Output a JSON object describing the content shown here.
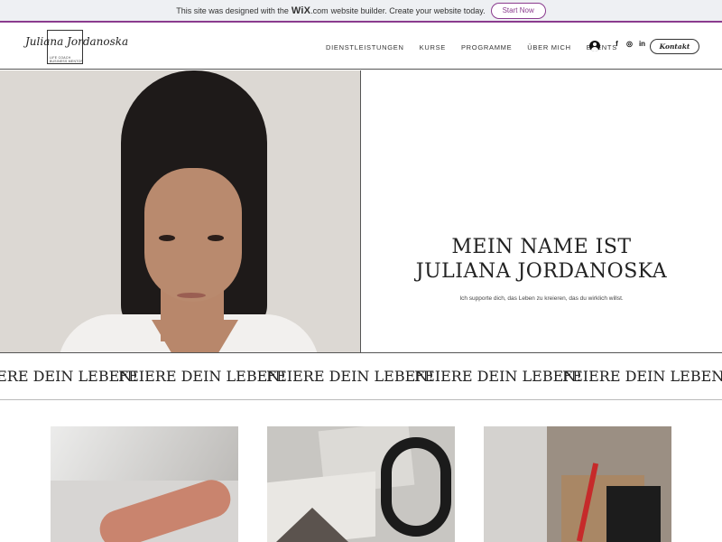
{
  "wix_banner": {
    "text_before": "This site was designed with the",
    "logo": "WiX",
    "logo_suffix": ".com",
    "text_after": "website builder. Create your website today.",
    "cta": "Start Now"
  },
  "header": {
    "logo": {
      "script_name": "Juliana Jordanoska",
      "line1": "LIFE COACH",
      "line2": "BUSINESS MENTOR"
    },
    "nav": [
      "DIENSTLEISTUNGEN",
      "KURSE",
      "PROGRAMME",
      "ÜBER MICH",
      "EVENTS"
    ],
    "social": [
      "f",
      "◎",
      "in"
    ],
    "contact_label": "Kontakt"
  },
  "hero": {
    "title_line1": "MEIN NAME IST",
    "title_line2": "JULIANA JORDANOSKA",
    "subtitle": "Ich supporte dich, das Leben zu kreieren, das du wirklich willst."
  },
  "marquee": {
    "items": [
      "FEIERE DEIN LEBEN!",
      "FEIERE DEIN LEBEN!",
      "FEIERE DEIN LEBEN!",
      "FEIERE DEIN LEBEN!",
      "FEIERE DEIN LEBEN!"
    ]
  },
  "colors": {
    "banner_accent": "#8a3b8e",
    "hero_bg": "#dcd8d3",
    "text": "#222222"
  }
}
